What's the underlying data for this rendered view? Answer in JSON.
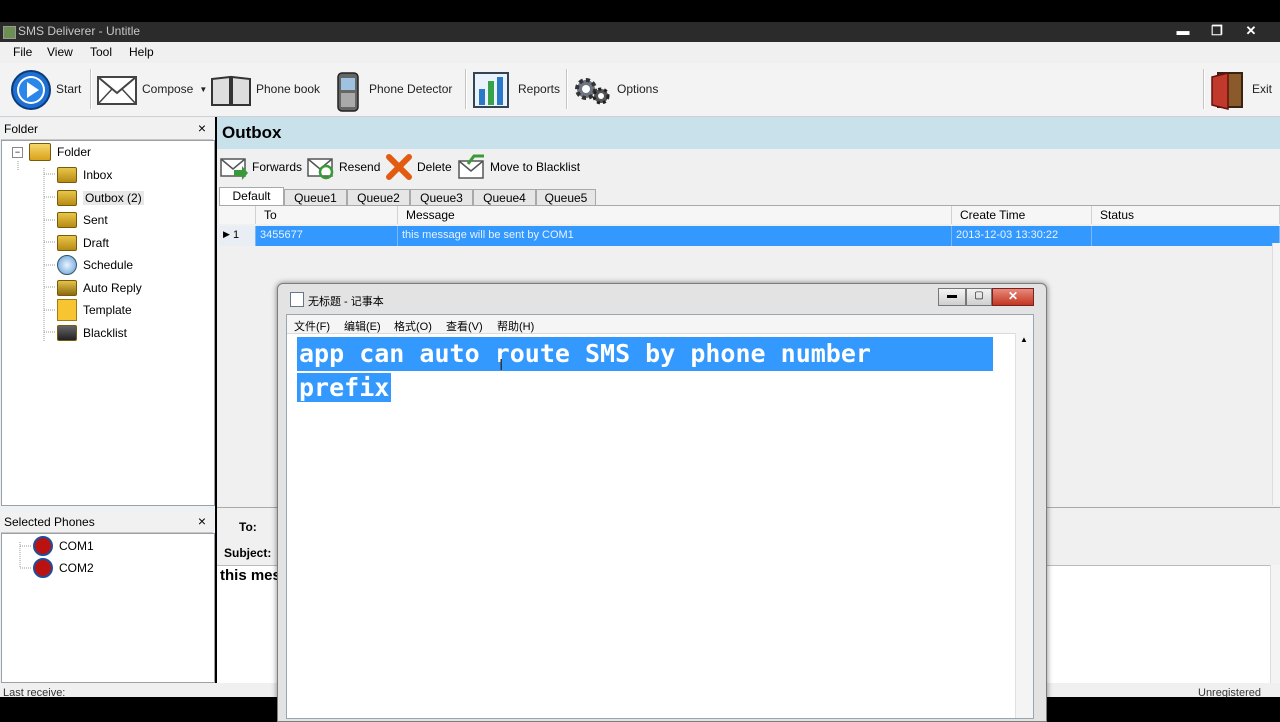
{
  "window": {
    "title": "SMS Deliverer - Untitle"
  },
  "menu": [
    "File",
    "View",
    "Tool",
    "Help"
  ],
  "toolbar": {
    "start": "Start",
    "compose": "Compose",
    "phonebook": "Phone book",
    "phonedetector": "Phone Detector",
    "reports": "Reports",
    "options": "Options",
    "exit": "Exit"
  },
  "folder_panel": {
    "title": "Folder",
    "root": "Folder",
    "items": [
      "Inbox",
      "Outbox (2)",
      "Sent",
      "Draft",
      "Schedule",
      "Auto Reply",
      "Template",
      "Blacklist"
    ]
  },
  "phones_panel": {
    "title": "Selected Phones",
    "items": [
      "COM1",
      "COM2"
    ]
  },
  "outbox": {
    "title": "Outbox",
    "actions": {
      "forwards": "Forwards",
      "resend": "Resend",
      "delete": "Delete",
      "blacklist": "Move to Blacklist"
    },
    "tabs": [
      "Default",
      "Queue1",
      "Queue2",
      "Queue3",
      "Queue4",
      "Queue5"
    ],
    "columns": [
      "To",
      "Message",
      "Create Time",
      "Status"
    ],
    "rows": [
      {
        "num": "1",
        "to": "3455677",
        "message": "this message will be sent by COM1",
        "time": "2013-12-03 13:30:22",
        "status": ""
      }
    ]
  },
  "detail": {
    "to_label": "To:",
    "subject_label": "Subject:",
    "body": "this mes"
  },
  "status": {
    "left": "Last receive:",
    "right": "Unregistered"
  },
  "notepad": {
    "title": "无标题 - 记事本",
    "menu": [
      "文件(F)",
      "编辑(E)",
      "格式(O)",
      "查看(V)",
      "帮助(H)"
    ],
    "line1": "app can auto route SMS by phone number",
    "line2": "prefix"
  },
  "colors": {
    "selection": "#3399ff",
    "header": "#c8e1ea"
  }
}
